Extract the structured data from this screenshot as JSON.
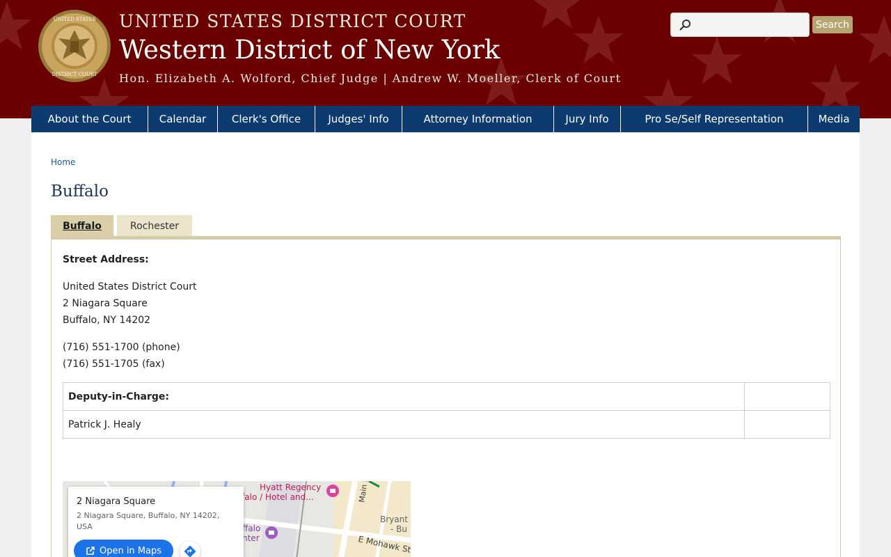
{
  "header": {
    "court_line1": "UNITED STATES DISTRICT COURT",
    "court_line2": "Western District of New York",
    "court_line3": "Hon. Elizabeth A. Wolford, Chief Judge | Andrew W. Moeller, Clerk of Court",
    "seal_text_top": "UNITED STATES",
    "seal_text_bottom": "DISTRICT COURT",
    "search": {
      "placeholder": "",
      "button_label": "Search"
    }
  },
  "nav": [
    {
      "label": "About the Court"
    },
    {
      "label": "Calendar"
    },
    {
      "label": "Clerk's Office"
    },
    {
      "label": "Judges' Info"
    },
    {
      "label": "Attorney Information"
    },
    {
      "label": "Jury Info"
    },
    {
      "label": "Pro Se/Self Representation"
    },
    {
      "label": "Media"
    }
  ],
  "breadcrumb": {
    "home": "Home"
  },
  "page": {
    "title": "Buffalo",
    "tabs": [
      {
        "label": "Buffalo",
        "active": true
      },
      {
        "label": "Rochester",
        "active": false
      }
    ],
    "street_address_label": "Street Address:",
    "address_lines": [
      "United States District Court",
      "2 Niagara Square",
      "Buffalo, NY 14202"
    ],
    "phone": "(716) 551-1700 (phone)",
    "fax": "(716) 551-1705 (fax)",
    "deputy_label": "Deputy-in-Charge:",
    "deputy_name": "Patrick J. Healy"
  },
  "map": {
    "card_title": "2 Niagara Square",
    "card_address": "2 Niagara Square, Buffalo, NY 14202, USA",
    "open_button": "Open in Maps",
    "labels": {
      "hyatt_1": "Hyatt Regency",
      "hyatt_2": "ffalo / Hotel and...",
      "main_st": "Main S",
      "bryant_1": "Bryant",
      "bryant_2": "- Bu",
      "falo": "ffalo",
      "nter": "nter",
      "mohawk": "E Mohawk St"
    }
  },
  "colors": {
    "banner": "#6b0000",
    "nav": "#0e3b6f",
    "tab_active": "#d9cfa9",
    "tab_inactive": "#ece5cc",
    "search_button": "#b5a572",
    "map_button": "#1a73e8"
  }
}
